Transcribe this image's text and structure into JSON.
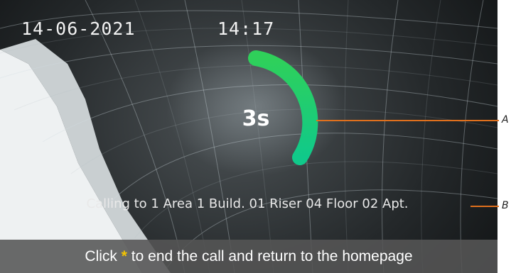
{
  "status_bar": {
    "date": "14-06-2021",
    "time": "14:17"
  },
  "countdown": {
    "label": "3s",
    "seconds": 3,
    "ring_color": "#1fcf6a"
  },
  "calling": {
    "text": "Calling to 1 Area 1 Build. 01 Riser 04 Floor 02 Apt."
  },
  "hint": {
    "before": "Click ",
    "key": "*",
    "after": " to end the call and return to the homepage",
    "key_color": "#f3c400"
  },
  "callouts": {
    "a": "A",
    "b": "B",
    "line_color": "#e0701d"
  }
}
